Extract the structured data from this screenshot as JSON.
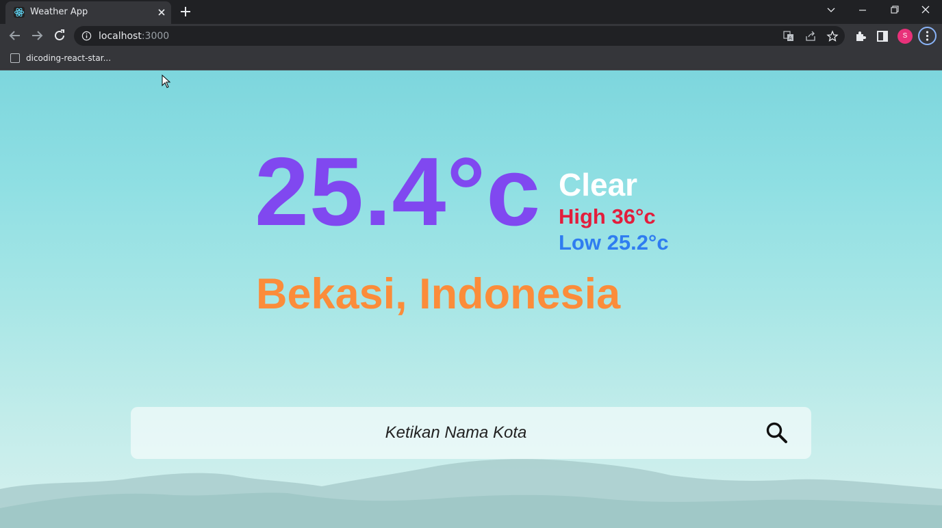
{
  "browser": {
    "tab_title": "Weather App",
    "url_host": "localhost",
    "url_port": ":3000",
    "bookmark_label": "dicoding-react-star...",
    "profile_initial": "S",
    "icons": [
      "react-icon",
      "close-icon",
      "plus-icon",
      "chevron-down-icon",
      "minimize-icon",
      "restore-icon",
      "back-icon",
      "forward-icon",
      "reload-icon",
      "info-icon",
      "translate-icon",
      "share-icon",
      "star-icon",
      "extensions-icon",
      "side-panel-icon",
      "more-icon"
    ]
  },
  "weather": {
    "temperature": "25.4°c",
    "condition": "Clear",
    "high": "High 36°c",
    "low": "Low 25.2°c",
    "location": "Bekasi, Indonesia"
  },
  "search": {
    "placeholder": "Ketikan Nama Kota",
    "icon": "search-icon"
  },
  "colors": {
    "temperature": "#8048f0",
    "condition": "#ffffff",
    "high": "#e21e3c",
    "low": "#2f7df0",
    "location": "#fb8c3a"
  }
}
